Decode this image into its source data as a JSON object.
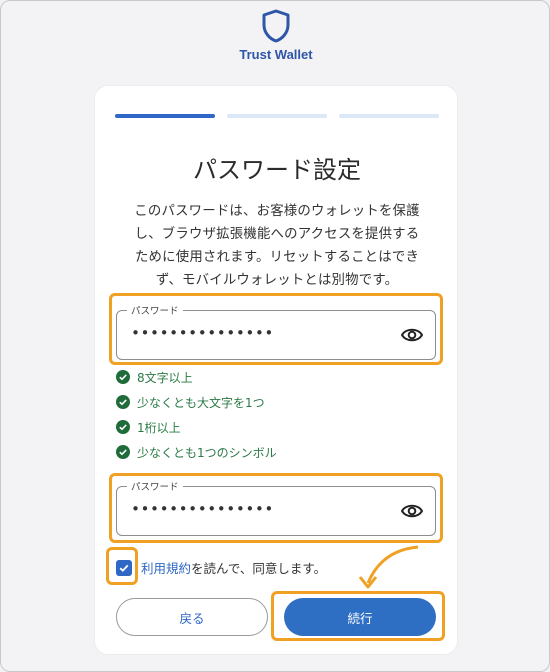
{
  "brand": {
    "name": "Trust Wallet",
    "icon": "shield-icon",
    "color": "#2e55a8"
  },
  "progress": {
    "total_steps": 3,
    "current_step": 1
  },
  "page": {
    "title": "パスワード設定",
    "description_lines": [
      "このパスワードは、お客様のウォレットを保護",
      "し、ブラウザ拡張機能へのアクセスを提供する",
      "ために使用されます。リセットすることはでき",
      "ず、モバイルウォレットとは別物です。"
    ]
  },
  "password_field": {
    "label": "パスワード",
    "value": "•••••••••••••••",
    "toggle_icon": "eye-icon"
  },
  "rules": [
    {
      "text": "8文字以上",
      "status": "met"
    },
    {
      "text": "少なくとも大文字を1つ",
      "status": "met"
    },
    {
      "text": "1桁以上",
      "status": "met"
    },
    {
      "text": "少なくとも1つのシンボル",
      "status": "met"
    }
  ],
  "confirm_field": {
    "label": "パスワード",
    "value": "•••••••••••••••",
    "toggle_icon": "eye-icon"
  },
  "agreement": {
    "checked": true,
    "link_text": "利用規約",
    "rest_text": "を読んで、同意します。"
  },
  "buttons": {
    "back": "戻る",
    "next": "続行"
  },
  "colors": {
    "accent": "#2e6fc3",
    "success": "#2a7a44",
    "highlight": "#f0a023"
  }
}
